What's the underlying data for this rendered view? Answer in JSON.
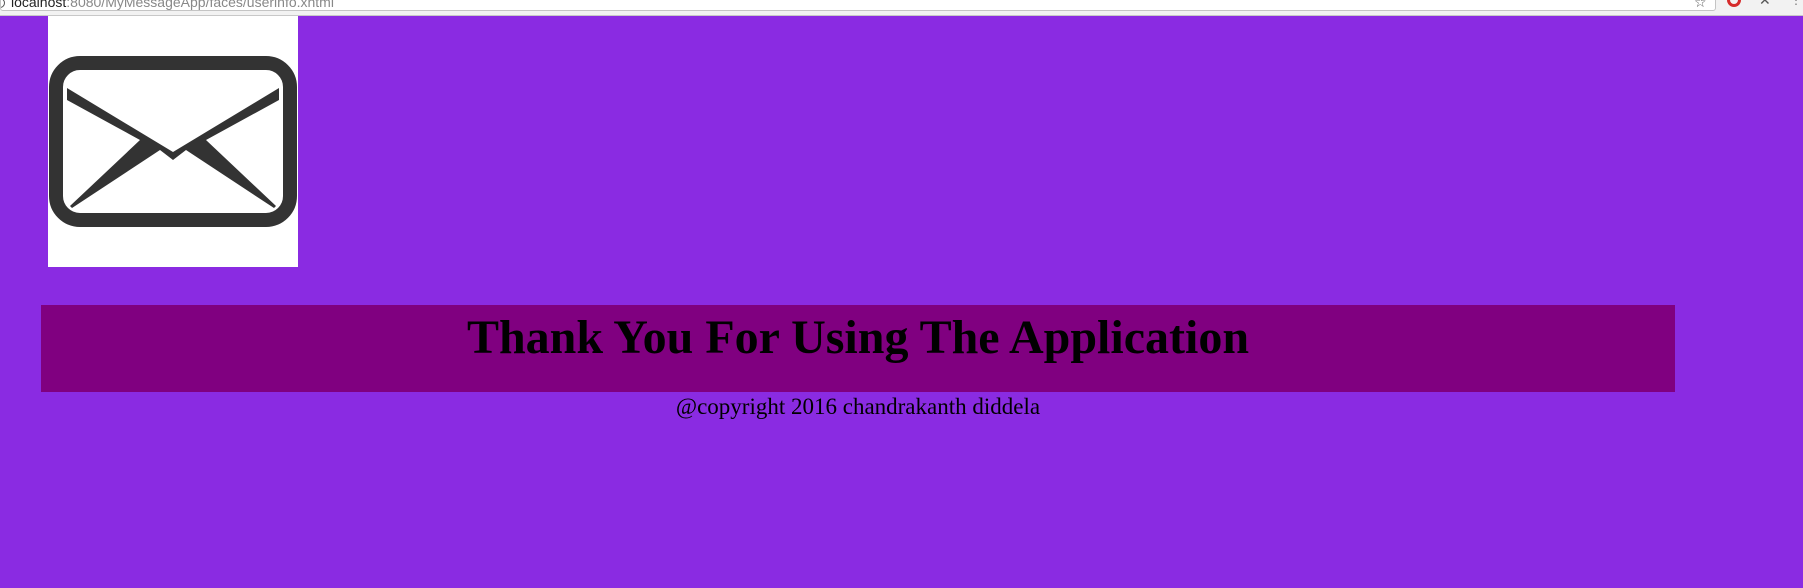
{
  "browser": {
    "url_host": "localhost",
    "url_path": ":8080/MyMessageApp/faces/userinfo.xhtml",
    "icons": [
      "info-icon",
      "star-icon",
      "opera-extension-icon",
      "tools-extension-icon",
      "extension-icon"
    ]
  },
  "logo": {
    "icon": "envelope-icon",
    "background": "#ffffff",
    "stroke_color": "#333333"
  },
  "banner": {
    "heading": "Thank You For Using The Application"
  },
  "footer": {
    "copyright": "@copyright 2016 chandrakanth diddela"
  },
  "colors": {
    "page_background": "#8a2be2",
    "banner_background": "#800080",
    "text": "#000000"
  }
}
